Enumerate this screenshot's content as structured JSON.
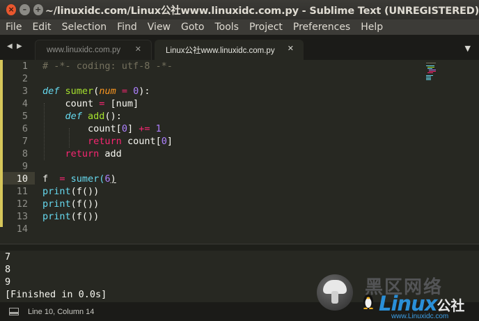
{
  "window": {
    "title": "~/linuxidc.com/Linux公社www.linuxidc.com.py - Sublime Text (UNREGISTERED)",
    "controls": {
      "close": "×",
      "minimize": "–",
      "maximize": "+"
    }
  },
  "menu": [
    "File",
    "Edit",
    "Selection",
    "Find",
    "View",
    "Goto",
    "Tools",
    "Project",
    "Preferences",
    "Help"
  ],
  "tabs": {
    "nav_prev": "◀",
    "nav_next": "▶",
    "items": [
      {
        "label": "www.linuxidc.com.py",
        "active": false,
        "close": "✕"
      },
      {
        "label": "Linux公社www.linuxidc.com.py",
        "active": true,
        "close": "✕"
      }
    ],
    "dropdown": "▼"
  },
  "editor": {
    "line_numbers": [
      "1",
      "2",
      "3",
      "4",
      "5",
      "6",
      "7",
      "8",
      "9",
      "10",
      "11",
      "12",
      "13",
      "14"
    ],
    "current_line": "10",
    "code": {
      "l1": "# -*- coding: utf-8 -*-",
      "l3": {
        "def": "def",
        "name": "sumer",
        "open": "(",
        "param": "num",
        "eq": " = ",
        "default": "0",
        "close": "):"
      },
      "l4": {
        "indent": "    ",
        "var": "count",
        "eq": " = ",
        "value": "[num]"
      },
      "l5": {
        "indent": "    ",
        "def": "def",
        "name": "add",
        "rest": "():"
      },
      "l6": {
        "indent": "        ",
        "var": "count[",
        "idx": "0",
        "mid": "] ",
        "op": "+=",
        "sp": " ",
        "val": "1"
      },
      "l7": {
        "indent": "        ",
        "kw": "return",
        "rest": " count[",
        "idx": "0",
        "end": "]"
      },
      "l8": {
        "indent": "    ",
        "kw": "return",
        "rest": " add"
      },
      "l10": {
        "var": "f  ",
        "op": "=",
        "sp": " ",
        "call": "sumer(",
        "arg": "6",
        "end": ")"
      },
      "l11": {
        "fn": "print",
        "rest": "(f())"
      },
      "l12": {
        "fn": "print",
        "rest": "(f())"
      },
      "l13": {
        "fn": "print",
        "rest": "(f())"
      }
    }
  },
  "output": [
    "7",
    "8",
    "9",
    "[Finished in 0.0s]"
  ],
  "status": {
    "position": "Line 10, Column 14"
  },
  "watermark": {
    "chinese": "黑区网络",
    "linux": "Linux",
    "zh": "公社",
    "url": "www.Linuxidc.com"
  },
  "colors": {
    "background": "#272822",
    "keyword": "#66d9ef",
    "function": "#a6e22e",
    "operator": "#f92672",
    "number": "#ae81ff",
    "comment": "#75715e",
    "param": "#fd971f",
    "modified_marker": "#d6c65a"
  }
}
